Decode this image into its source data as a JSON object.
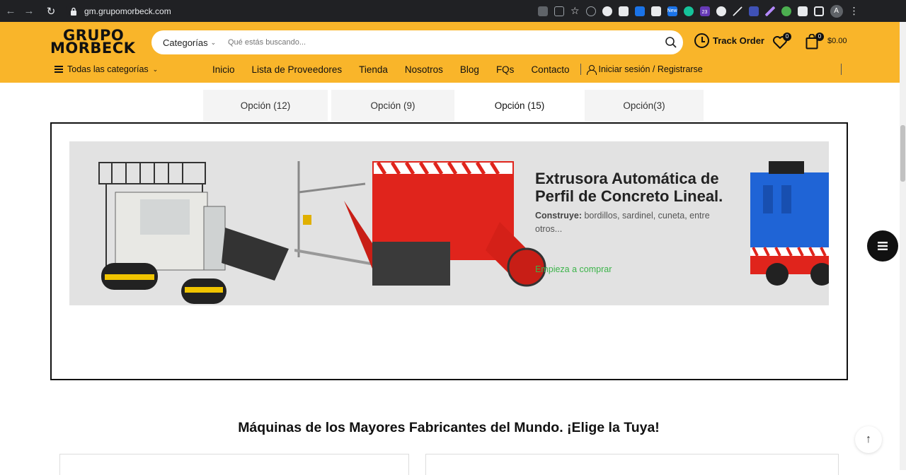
{
  "browser": {
    "url": "gm.grupomorbeck.com",
    "extensions": [
      "translate-icon",
      "share-icon",
      "star-icon",
      "recycle-icon",
      "globe-icon",
      "flag-icon",
      "doc-icon",
      "camera-icon",
      "new-badge-icon",
      "grammarly-icon",
      "counter-icon",
      "swirl-icon",
      "pen-icon",
      "video-icon",
      "quill-icon",
      "eye-icon",
      "puzzle-icon",
      "sidebar-icon"
    ],
    "new_badge": "New",
    "ext_count": "23",
    "avatar_letter": "A"
  },
  "header": {
    "logo_line1": "GRUPO",
    "logo_line2": "MORBECK",
    "search": {
      "category_label": "Categorías",
      "placeholder": "Qué estás buscando..."
    },
    "track_order": "Track Order",
    "wishlist_count": "0",
    "cart_count": "0",
    "cart_total": "$0.00",
    "all_categories": "Todas las categorías",
    "nav": [
      "Inicio",
      "Lista de Proveedores",
      "Tienda",
      "Nosotros",
      "Blog",
      "FQs",
      "Contacto"
    ],
    "login": "Iniciar sesión / Registrarse",
    "accent": "#f9b52a"
  },
  "tabs": [
    {
      "label": "Opción (12)",
      "active": false
    },
    {
      "label": "Opción (9)",
      "active": false
    },
    {
      "label": "Opción (15)",
      "active": true
    },
    {
      "label": "Opción(3)",
      "active": false
    }
  ],
  "banner": {
    "title": "Extrusora Automática de Perfil de Concreto Lineal.",
    "desc_bold": "Construye:",
    "desc_rest": " bordillos, sardinel,  cuneta, entre otros...",
    "cta": "Empieza a comprar",
    "cta_color": "#3cb44a"
  },
  "section": {
    "heading": "Máquinas de los Mayores Fabricantes del Mundo. ¡Elige la Tuya!"
  }
}
